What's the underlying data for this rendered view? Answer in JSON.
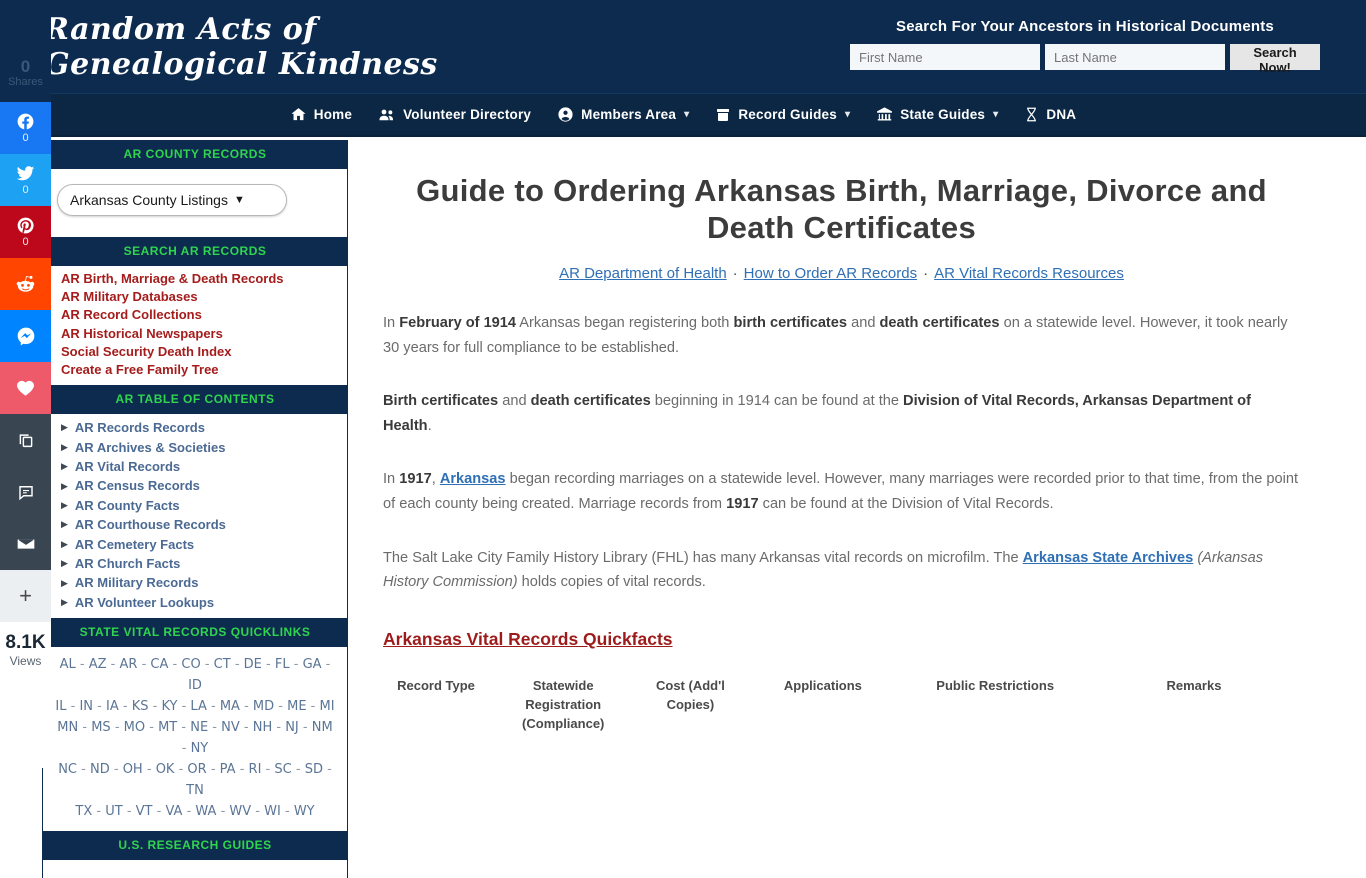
{
  "share_rail": {
    "total_count": "0",
    "total_label": "Shares",
    "buttons": [
      {
        "icon": "facebook-icon",
        "count": "0"
      },
      {
        "icon": "twitter-icon",
        "count": "0"
      },
      {
        "icon": "pinterest-icon",
        "count": "0"
      },
      {
        "icon": "reddit-icon",
        "count": ""
      },
      {
        "icon": "messenger-icon",
        "count": ""
      },
      {
        "icon": "heart-icon",
        "count": ""
      },
      {
        "icon": "copy-icon",
        "count": ""
      },
      {
        "icon": "comment-icon",
        "count": ""
      },
      {
        "icon": "email-icon",
        "count": ""
      }
    ],
    "more_label": "+",
    "views_count": "8.1K",
    "views_label": "Views"
  },
  "header": {
    "brand": "Random Acts of\nGenealogical Kindness",
    "search_tagline": "Search For Your Ancestors in Historical Documents",
    "first_name_placeholder": "First Name",
    "last_name_placeholder": "Last Name",
    "search_button": "Search Now!"
  },
  "nav": {
    "items": [
      {
        "label": "Home",
        "icon": "home-icon",
        "has_caret": false
      },
      {
        "label": "Volunteer Directory",
        "icon": "users-icon",
        "has_caret": false
      },
      {
        "label": "Members Area",
        "icon": "user-circle-icon",
        "has_caret": true
      },
      {
        "label": "Record Guides",
        "icon": "archive-box-icon",
        "has_caret": true
      },
      {
        "label": "State Guides",
        "icon": "bank-icon",
        "has_caret": true
      },
      {
        "label": "DNA",
        "icon": "dna-icon",
        "has_caret": false
      }
    ]
  },
  "sidebar": {
    "panels": [
      {
        "title": "AR COUNTY RECORDS",
        "type": "select",
        "select_value": "Arkansas County Listings",
        "select_arrow": "▼"
      },
      {
        "title": "SEARCH AR RECORDS",
        "type": "links",
        "items": [
          "AR Birth, Marriage & Death Records",
          "AR Military Databases",
          "AR Record Collections",
          "AR Historical Newspapers",
          "Social Security Death Index",
          "Create a Free Family Tree"
        ]
      },
      {
        "title": "AR TABLE OF CONTENTS",
        "type": "toc",
        "items": [
          "AR Records Records",
          "AR Archives & Societies",
          "AR Vital Records",
          "AR Census Records",
          "AR County Facts",
          "AR Courthouse Records",
          "AR Cemetery Facts",
          "AR Church Facts",
          "AR Military Records",
          "AR Volunteer Lookups"
        ]
      },
      {
        "title": "STATE VITAL RECORDS QUICKLINKS",
        "type": "states",
        "rows": [
          [
            "AL",
            "AZ",
            "AR",
            "CA",
            "CO",
            "CT",
            "DE",
            "FL",
            "GA",
            "ID"
          ],
          [
            "IL",
            "IN",
            "IA",
            "KS",
            "KY",
            "LA",
            "MA",
            "MD",
            "ME",
            "MI"
          ],
          [
            "MN",
            "MS",
            "MO",
            "MT",
            "NE",
            "NV",
            "NH",
            "NJ",
            "NM",
            "NY"
          ],
          [
            "NC",
            "ND",
            "OH",
            "OK",
            "OR",
            "PA",
            "RI",
            "SC",
            "SD",
            "TN"
          ],
          [
            "TX",
            "UT",
            "VT",
            "VA",
            "WA",
            "WV",
            "WI",
            "WY"
          ]
        ]
      },
      {
        "title": "U.S. RESEARCH GUIDES",
        "type": "empty"
      }
    ]
  },
  "main": {
    "page_title": "Guide to Ordering Arkansas Birth, Marriage, Divorce and Death Certificates",
    "title_links": [
      "AR Department of Health",
      "How to Order AR Records",
      "AR Vital Records Resources"
    ],
    "title_link_separator": "·",
    "paragraph_1": {
      "s1": "In ",
      "b1": "February of 1914",
      "s2": " Arkansas began registering both ",
      "b2": "birth certificates",
      "s3": " and ",
      "b3": "death certificates",
      "s4": " on a statewide level. However, it took nearly 30 years for full compliance to be established."
    },
    "paragraph_2": {
      "b1": "Birth certificates",
      "s1": " and ",
      "b2": "death certificates",
      "s2": " beginning in 1914 can be found at the ",
      "b3": "Division of Vital Records, Arkansas Department of Health",
      "s3": "."
    },
    "paragraph_3": {
      "s1": "In ",
      "b1": "1917",
      "s2": ", ",
      "a1": "Arkansas",
      "s3": " began recording marriages on a statewide level. However, many marriages were recorded prior to that time, from the point of each county being created. Marriage records from ",
      "b2": "1917",
      "s4": " can be found at the Division of Vital Records."
    },
    "paragraph_4": {
      "s1": "The Salt Lake City Family History Library (FHL) has many Arkansas vital records on microfilm. The ",
      "a1": "Arkansas State Archives",
      "s2": " ",
      "i1": "(Arkansas History Commission)",
      "s3": " holds copies of vital records."
    },
    "quickfacts_heading": "Arkansas Vital Records Quickfacts",
    "facts_table_headers": [
      "Record Type",
      "Statewide Registration (Compliance)",
      "Cost (Add'l Copies)",
      "Applications",
      "Public Restrictions",
      "Remarks"
    ]
  },
  "colors": {
    "header_navy": "#0d2b4e",
    "nav_navy": "#0b2743",
    "panel_heading_green": "#2fd44f",
    "sidebar_link_red": "#a51c1c",
    "toc_link_blue": "#4b6a93",
    "content_link_blue": "#2f6fb5",
    "heading_dark_red": "#9e1b1b",
    "body_gray": "#6b6b6b"
  }
}
